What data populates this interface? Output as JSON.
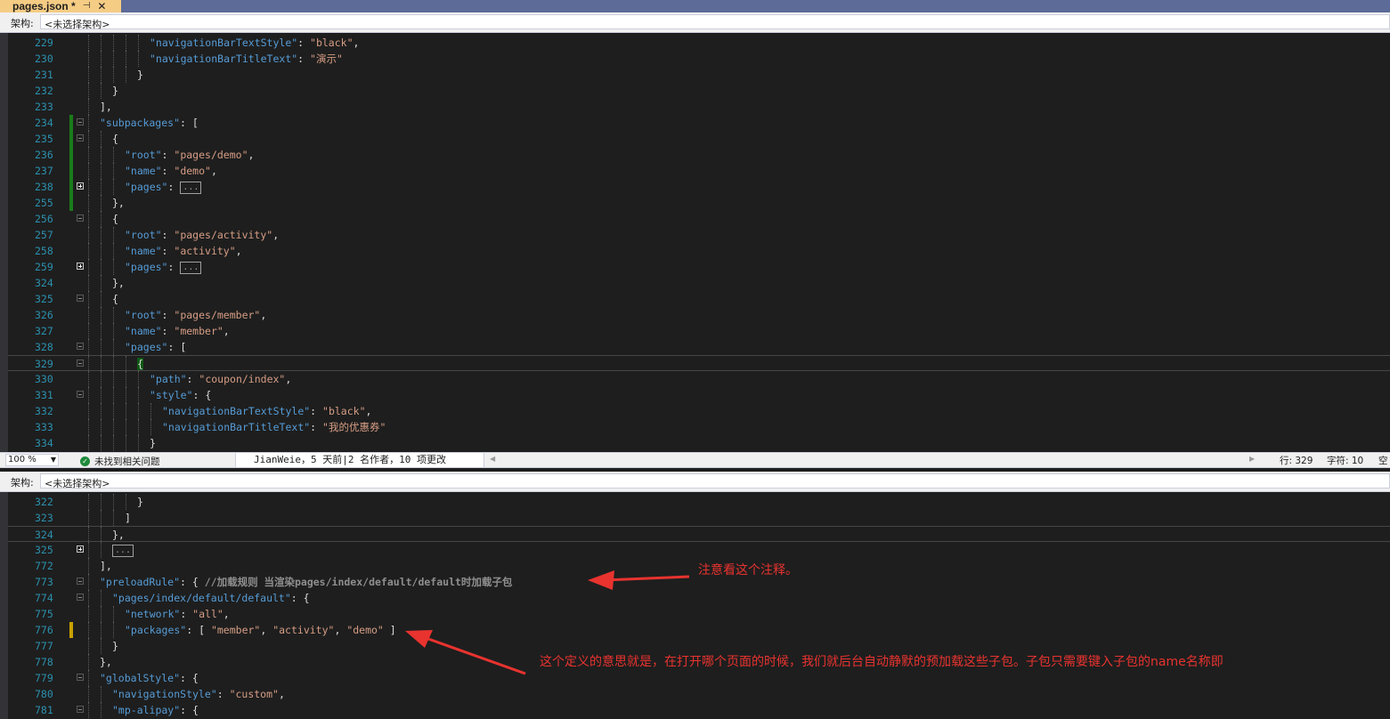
{
  "tab": {
    "title": "pages.json *",
    "pin_icon": "pin-icon",
    "close_icon": "close-icon"
  },
  "arch_top": {
    "label": "架构:",
    "value": "<未选择架构>"
  },
  "arch_bottom": {
    "label": "架构:",
    "value": "<未选择架构>"
  },
  "status": {
    "zoom": "100 %",
    "issues": "未找到相关问题",
    "blame": "JianWeie，5 天前|2 名作者，10 项更改",
    "row": "行: 329",
    "col": "字符: 10",
    "space": "空"
  },
  "top_editor": {
    "lines": [
      {
        "num": "229",
        "depth": 5,
        "tokens": [
          [
            "k",
            "\"navigationBarTextStyle\""
          ],
          [
            "p",
            ": "
          ],
          [
            "s",
            "\"black\""
          ],
          [
            "p",
            ","
          ]
        ]
      },
      {
        "num": "230",
        "depth": 5,
        "tokens": [
          [
            "k",
            "\"navigationBarTitleText\""
          ],
          [
            "p",
            ": "
          ],
          [
            "s",
            "\"演示\""
          ]
        ]
      },
      {
        "num": "231",
        "depth": 4,
        "tokens": [
          [
            "p",
            "}"
          ]
        ]
      },
      {
        "num": "232",
        "depth": 2,
        "tokens": [
          [
            "p",
            "}"
          ]
        ]
      },
      {
        "num": "233",
        "depth": 1,
        "tokens": [
          [
            "p",
            "],"
          ]
        ]
      },
      {
        "num": "234",
        "depth": 1,
        "fold": "minus",
        "change": "#1a7b1a",
        "tokens": [
          [
            "k",
            "\"subpackages\""
          ],
          [
            "p",
            ": ["
          ]
        ]
      },
      {
        "num": "235",
        "depth": 2,
        "fold": "minus",
        "change": "#1a7b1a",
        "tokens": [
          [
            "p",
            "{"
          ]
        ]
      },
      {
        "num": "236",
        "depth": 3,
        "change": "#1a7b1a",
        "tokens": [
          [
            "k",
            "\"root\""
          ],
          [
            "p",
            ": "
          ],
          [
            "s",
            "\"pages/demo\""
          ],
          [
            "p",
            ","
          ]
        ]
      },
      {
        "num": "237",
        "depth": 3,
        "change": "#1a7b1a",
        "tokens": [
          [
            "k",
            "\"name\""
          ],
          [
            "p",
            ": "
          ],
          [
            "s",
            "\"demo\""
          ],
          [
            "p",
            ","
          ]
        ]
      },
      {
        "num": "238",
        "depth": 3,
        "fold": "plus",
        "change": "#1a7b1a",
        "tokens": [
          [
            "k",
            "\"pages\""
          ],
          [
            "p",
            ": "
          ],
          [
            "e",
            "..."
          ]
        ]
      },
      {
        "num": "255",
        "depth": 2,
        "change": "#1a7b1a",
        "tokens": [
          [
            "p",
            "},"
          ]
        ]
      },
      {
        "num": "256",
        "depth": 2,
        "fold": "minus",
        "tokens": [
          [
            "p",
            "{"
          ]
        ]
      },
      {
        "num": "257",
        "depth": 3,
        "tokens": [
          [
            "k",
            "\"root\""
          ],
          [
            "p",
            ": "
          ],
          [
            "s",
            "\"pages/activity\""
          ],
          [
            "p",
            ","
          ]
        ]
      },
      {
        "num": "258",
        "depth": 3,
        "tokens": [
          [
            "k",
            "\"name\""
          ],
          [
            "p",
            ": "
          ],
          [
            "s",
            "\"activity\""
          ],
          [
            "p",
            ","
          ]
        ]
      },
      {
        "num": "259",
        "depth": 3,
        "fold": "plus",
        "tokens": [
          [
            "k",
            "\"pages\""
          ],
          [
            "p",
            ": "
          ],
          [
            "e",
            "..."
          ]
        ]
      },
      {
        "num": "324",
        "depth": 2,
        "tokens": [
          [
            "p",
            "},"
          ]
        ]
      },
      {
        "num": "325",
        "depth": 2,
        "fold": "minus",
        "tokens": [
          [
            "p",
            "{"
          ]
        ]
      },
      {
        "num": "326",
        "depth": 3,
        "tokens": [
          [
            "k",
            "\"root\""
          ],
          [
            "p",
            ": "
          ],
          [
            "s",
            "\"pages/member\""
          ],
          [
            "p",
            ","
          ]
        ]
      },
      {
        "num": "327",
        "depth": 3,
        "tokens": [
          [
            "k",
            "\"name\""
          ],
          [
            "p",
            ": "
          ],
          [
            "s",
            "\"member\""
          ],
          [
            "p",
            ","
          ]
        ]
      },
      {
        "num": "328",
        "depth": 3,
        "fold": "minus",
        "tokens": [
          [
            "k",
            "\"pages\""
          ],
          [
            "p",
            ": ["
          ]
        ]
      },
      {
        "num": "329",
        "depth": 4,
        "fold": "minus",
        "current": true,
        "tokens": [
          [
            "h",
            "{"
          ]
        ]
      },
      {
        "num": "330",
        "depth": 5,
        "tokens": [
          [
            "k",
            "\"path\""
          ],
          [
            "p",
            ": "
          ],
          [
            "s",
            "\"coupon/index\""
          ],
          [
            "p",
            ","
          ]
        ]
      },
      {
        "num": "331",
        "depth": 5,
        "fold": "minus",
        "tokens": [
          [
            "k",
            "\"style\""
          ],
          [
            "p",
            ": {"
          ]
        ]
      },
      {
        "num": "332",
        "depth": 6,
        "tokens": [
          [
            "k",
            "\"navigationBarTextStyle\""
          ],
          [
            "p",
            ": "
          ],
          [
            "s",
            "\"black\""
          ],
          [
            "p",
            ","
          ]
        ]
      },
      {
        "num": "333",
        "depth": 6,
        "tokens": [
          [
            "k",
            "\"navigationBarTitleText\""
          ],
          [
            "p",
            ": "
          ],
          [
            "s",
            "\"我的优惠券\""
          ]
        ]
      },
      {
        "num": "334",
        "depth": 5,
        "tokens": [
          [
            "p",
            "}"
          ]
        ]
      }
    ]
  },
  "bottom_editor": {
    "lines": [
      {
        "num": "322",
        "depth": 4,
        "tokens": [
          [
            "p",
            "}"
          ]
        ]
      },
      {
        "num": "323",
        "depth": 3,
        "tokens": [
          [
            "p",
            "]"
          ]
        ]
      },
      {
        "num": "324",
        "depth": 2,
        "current": true,
        "tokens": [
          [
            "p",
            "},"
          ]
        ]
      },
      {
        "num": "325",
        "depth": 2,
        "fold": "plus",
        "tokens": [
          [
            "e",
            "..."
          ]
        ]
      },
      {
        "num": "772",
        "depth": 1,
        "tokens": [
          [
            "p",
            "],"
          ]
        ]
      },
      {
        "num": "773",
        "depth": 1,
        "fold": "minus",
        "tokens": [
          [
            "k",
            "\"preloadRule\""
          ],
          [
            "p",
            ": { "
          ],
          [
            "cm",
            "//加载规则 当渲染pages/index/default/default时加载子包"
          ]
        ]
      },
      {
        "num": "774",
        "depth": 2,
        "fold": "minus",
        "tokens": [
          [
            "k",
            "\"pages/index/default/default\""
          ],
          [
            "p",
            ": {"
          ]
        ]
      },
      {
        "num": "775",
        "depth": 3,
        "tokens": [
          [
            "k",
            "\"network\""
          ],
          [
            "p",
            ": "
          ],
          [
            "s",
            "\"all\""
          ],
          [
            "p",
            ","
          ]
        ]
      },
      {
        "num": "776",
        "depth": 3,
        "change": "#c8a000",
        "tokens": [
          [
            "k",
            "\"packages\""
          ],
          [
            "p",
            ": [ "
          ],
          [
            "s",
            "\"member\""
          ],
          [
            "p",
            ", "
          ],
          [
            "s",
            "\"activity\""
          ],
          [
            "p",
            ", "
          ],
          [
            "s",
            "\"demo\""
          ],
          [
            "p",
            " ]"
          ]
        ]
      },
      {
        "num": "777",
        "depth": 2,
        "tokens": [
          [
            "p",
            "}"
          ]
        ]
      },
      {
        "num": "778",
        "depth": 1,
        "tokens": [
          [
            "p",
            "},"
          ]
        ]
      },
      {
        "num": "779",
        "depth": 1,
        "fold": "minus",
        "tokens": [
          [
            "k",
            "\"globalStyle\""
          ],
          [
            "p",
            ": {"
          ]
        ]
      },
      {
        "num": "780",
        "depth": 2,
        "tokens": [
          [
            "k",
            "\"navigationStyle\""
          ],
          [
            "p",
            ": "
          ],
          [
            "s",
            "\"custom\""
          ],
          [
            "p",
            ","
          ]
        ]
      },
      {
        "num": "781",
        "depth": 2,
        "fold": "minus",
        "tokens": [
          [
            "k",
            "\"mp-alipay\""
          ],
          [
            "p",
            ": {"
          ]
        ]
      }
    ]
  },
  "annotations": {
    "note1": "注意看这个注释。",
    "note2": "这个定义的意思就是，在打开哪个页面的时候，我们就后台自动静默的预加载这些子包。子包只需要键入子包的name名称即"
  },
  "colors": {
    "annotation": "#e8332f",
    "key": "#569cd6",
    "string": "#d69d85",
    "line_number": "#2b91af"
  }
}
